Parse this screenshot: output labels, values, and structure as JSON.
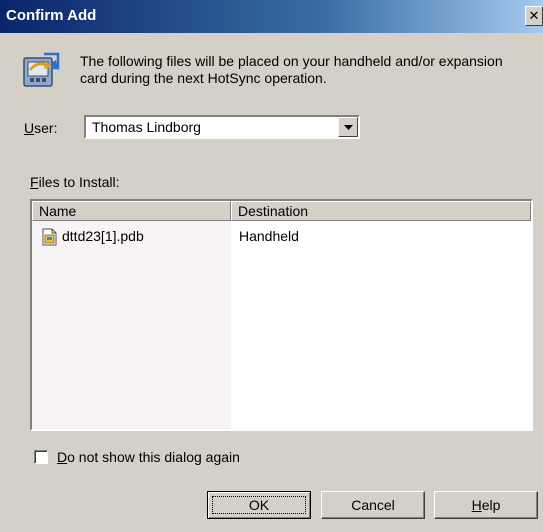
{
  "window": {
    "title": "Confirm Add",
    "close_glyph": "✕"
  },
  "header": {
    "icon": "hotsync-install-icon",
    "message": "The following files will be placed on your handheld and/or expansion card during the next HotSync operation."
  },
  "user": {
    "label_mnemonic": "U",
    "label_rest": "ser:",
    "selected_value": "Thomas Lindborg"
  },
  "files": {
    "label_mnemonic": "F",
    "label_rest": "iles to Install:",
    "columns": [
      "Name",
      "Destination"
    ],
    "rows": [
      {
        "name": "dttd23[1].pdb",
        "destination": "Handheld"
      }
    ]
  },
  "options": {
    "dont_show_mnemonic": "D",
    "dont_show_rest": "o not show this dialog again",
    "dont_show_checked": false
  },
  "buttons": {
    "ok": "OK",
    "cancel": "Cancel",
    "help_mnemonic": "H",
    "help_rest": "elp"
  },
  "colors": {
    "title_bar": "#0a246a",
    "dialog_face": "#d4d0c8",
    "name_column_bg": "#f7f3f7"
  }
}
